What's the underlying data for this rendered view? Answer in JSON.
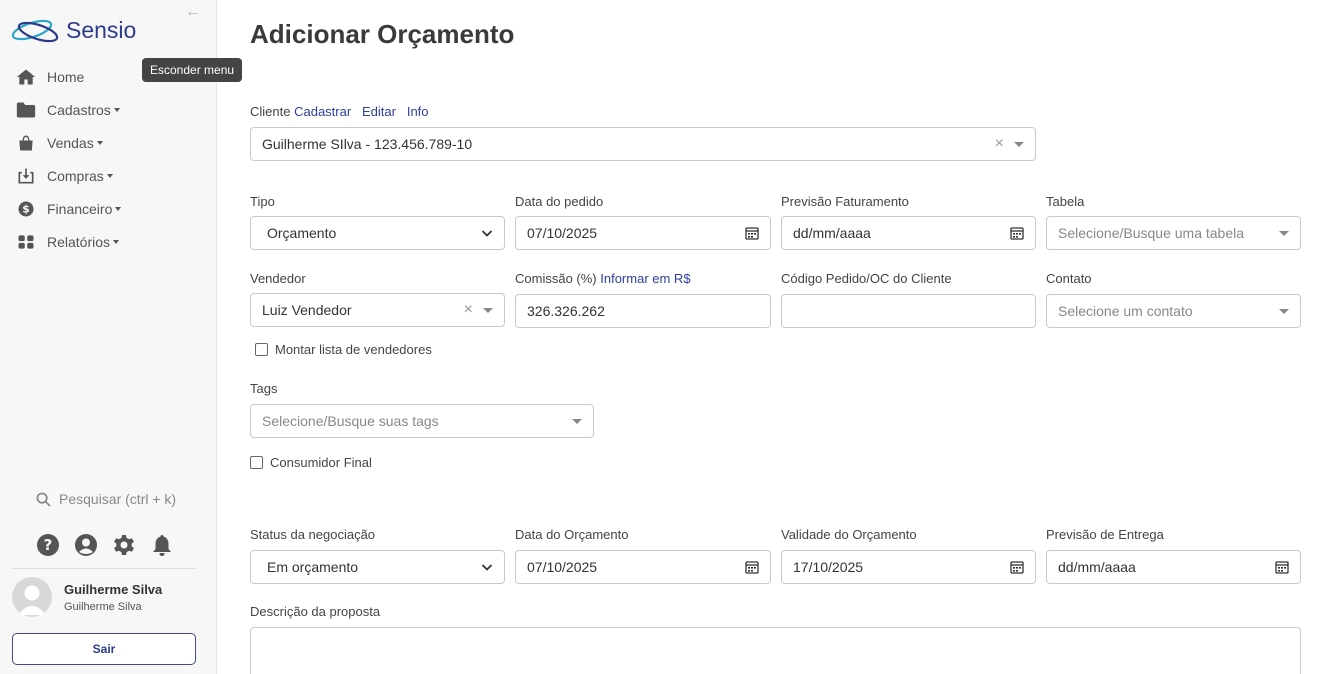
{
  "brand": {
    "name": "Sensio",
    "color": "#2c3a8a",
    "accent": "#2aa6c9"
  },
  "sidebar": {
    "collapse_tooltip": "Esconder menu",
    "items": [
      {
        "label": "Home",
        "icon": "home-icon",
        "has_submenu": false
      },
      {
        "label": "Cadastros",
        "icon": "folder-icon",
        "has_submenu": true
      },
      {
        "label": "Vendas",
        "icon": "shopping-bag-icon",
        "has_submenu": true
      },
      {
        "label": "Compras",
        "icon": "download-box-icon",
        "has_submenu": true
      },
      {
        "label": "Financeiro",
        "icon": "dollar-icon",
        "has_submenu": true
      },
      {
        "label": "Relatórios",
        "icon": "grid-icon",
        "has_submenu": true
      }
    ],
    "search_placeholder": "Pesquisar (ctrl + k)",
    "util_icons": [
      "help-icon",
      "user-circle-icon",
      "gear-icon",
      "bell-icon"
    ],
    "user": {
      "name": "Guilherme Silva",
      "subtitle": "Guilherme Silva"
    },
    "logout_label": "Sair"
  },
  "page": {
    "title": "Adicionar Orçamento"
  },
  "form": {
    "cliente": {
      "label": "Cliente",
      "links": [
        "Cadastrar",
        "Editar",
        "Info"
      ],
      "value": "Guilherme SIlva - 123.456.789-10"
    },
    "tipo": {
      "label": "Tipo",
      "value": "Orçamento"
    },
    "data_pedido": {
      "label": "Data do pedido",
      "value": "07/10/2025"
    },
    "previsao_faturamento": {
      "label": "Previsão Faturamento",
      "value": "dd/mm/aaaa"
    },
    "tabela": {
      "label": "Tabela",
      "placeholder": "Selecione/Busque uma tabela"
    },
    "vendedor": {
      "label": "Vendedor",
      "value": "Luiz Vendedor"
    },
    "comissao": {
      "label": "Comissão (%)",
      "link": "Informar em R$",
      "value": "326.326.262"
    },
    "codigo_pedido": {
      "label": "Código Pedido/OC do Cliente",
      "value": ""
    },
    "contato": {
      "label": "Contato",
      "placeholder": "Selecione um contato"
    },
    "montar_lista": {
      "label": "Montar lista de vendedores",
      "checked": false
    },
    "tags": {
      "label": "Tags",
      "placeholder": "Selecione/Busque suas tags"
    },
    "consumidor_final": {
      "label": "Consumidor Final",
      "checked": false
    },
    "status_negociacao": {
      "label": "Status da negociação",
      "value": "Em orçamento"
    },
    "data_orcamento": {
      "label": "Data do Orçamento",
      "value": "07/10/2025"
    },
    "validade_orcamento": {
      "label": "Validade do Orçamento",
      "value": "17/10/2025"
    },
    "previsao_entrega": {
      "label": "Previsão de Entrega",
      "value": "dd/mm/aaaa"
    },
    "descricao": {
      "label": "Descrição da proposta",
      "value": ""
    }
  }
}
